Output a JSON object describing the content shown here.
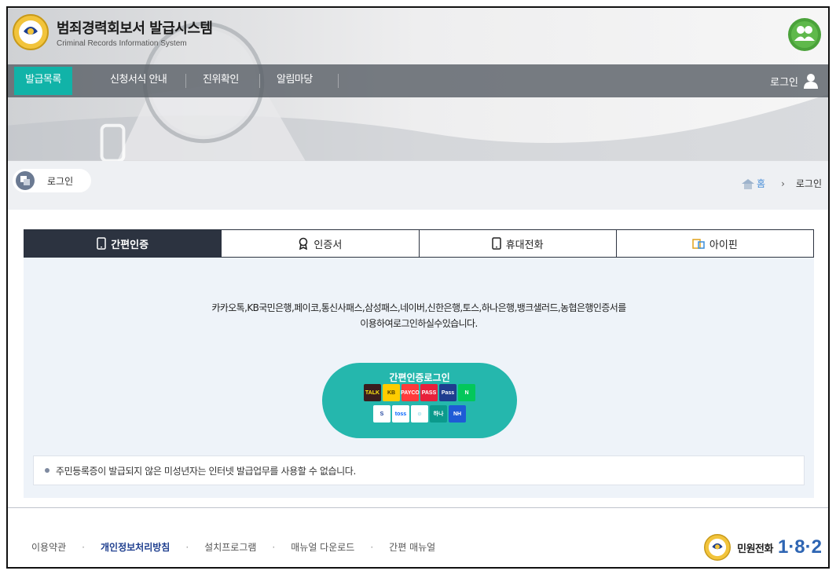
{
  "header": {
    "title": "범죄경력회보서 발급시스템",
    "subtitle": "Criminal Records Information System"
  },
  "nav": {
    "items": [
      {
        "label": "발급목록"
      },
      {
        "label": "신청서식 안내"
      },
      {
        "label": "진위확인"
      },
      {
        "label": "알림마당"
      }
    ],
    "login": "로그인"
  },
  "page": {
    "title": "로그인",
    "breadcrumb": {
      "home": "홈",
      "current": "로그인"
    }
  },
  "tabs": [
    {
      "label": "간편인증",
      "icon": "mobile-icon"
    },
    {
      "label": "인증서",
      "icon": "certificate-icon"
    },
    {
      "label": "휴대전화",
      "icon": "mobile-icon"
    },
    {
      "label": "아이핀",
      "icon": "ipin-icon"
    }
  ],
  "content": {
    "desc_line1": "카카오톡,KB국민은행,페이코,통신사패스,삼성패스,네이버,신한은행,토스,하나은행,뱅크샐러드,농협은행인증서를",
    "desc_line2": "이용하여로그인하실수있습니다.",
    "button_label": "간편인증로그인",
    "provider_icons_row1": [
      {
        "text": "TALK",
        "bg": "#3a1d1d",
        "fg": "#ffe812"
      },
      {
        "text": "KB",
        "bg": "#ffcc00",
        "fg": "#4a3b00"
      },
      {
        "text": "PAYCO",
        "bg": "#ff3b3b",
        "fg": "#ffffff"
      },
      {
        "text": "PASS",
        "bg": "#e8213b",
        "fg": "#ffffff"
      },
      {
        "text": "Pass",
        "bg": "#1f3c8f",
        "fg": "#ffffff"
      },
      {
        "text": "N",
        "bg": "#03c75a",
        "fg": "#ffffff"
      }
    ],
    "provider_icons_row2": [
      {
        "text": "S",
        "bg": "#ffffff",
        "fg": "#1a3f9c"
      },
      {
        "text": "toss",
        "bg": "#ffffff",
        "fg": "#0064ff"
      },
      {
        "text": "☺",
        "bg": "#ffffff",
        "fg": "#20b3d8"
      },
      {
        "text": "하나",
        "bg": "#0b9a8c",
        "fg": "#ffffff"
      },
      {
        "text": "NH",
        "bg": "#1e5bd6",
        "fg": "#ffffff"
      }
    ],
    "notice": "주민등록증이 발급되지 않은 미성년자는 인터넷 발급업무를 사용할 수 없습니다."
  },
  "footer": {
    "links": [
      "이용약관",
      "개인정보처리방침",
      "설치프로그램",
      "매뉴얼 다운로드",
      "간편 매뉴얼"
    ],
    "call_label": "민원전화",
    "call_number": "1·8·2"
  },
  "colors": {
    "accent": "#11b3a8",
    "tab_active": "#2c3340",
    "footer_highlight": "#1f3f8f",
    "call_number": "#2e65b3"
  }
}
